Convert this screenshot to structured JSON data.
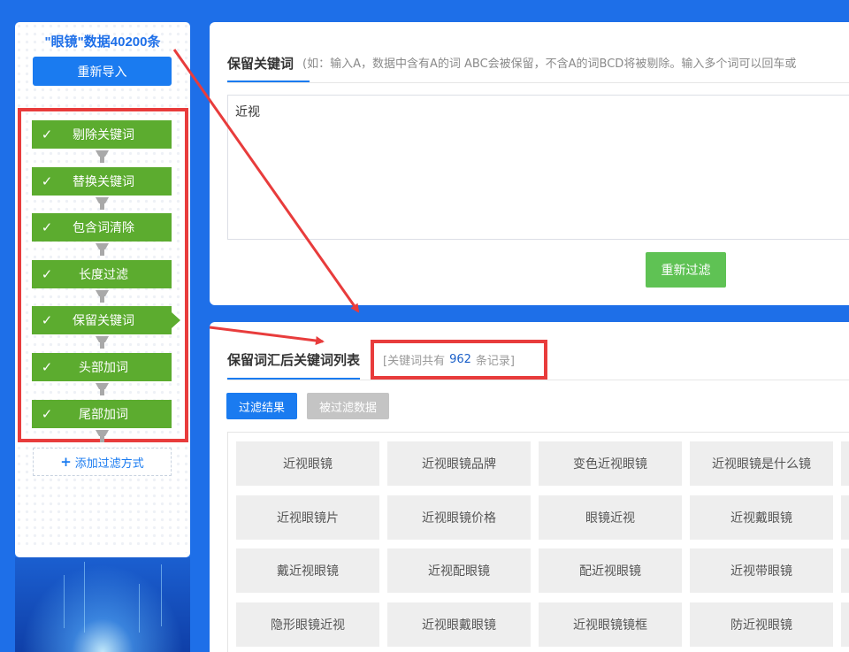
{
  "sidebar": {
    "dataset_title": "\"眼镜\"数据40200条",
    "reimport_label": "重新导入",
    "check_glyph": "✓",
    "steps": [
      {
        "label": "剔除关键词"
      },
      {
        "label": "替换关键词"
      },
      {
        "label": "包含词清除"
      },
      {
        "label": "长度过滤"
      },
      {
        "label": "保留关键词"
      },
      {
        "label": "头部加词"
      },
      {
        "label": "尾部加词"
      }
    ],
    "active_step": "保留关键词",
    "add_filter_label": "添加过滤方式"
  },
  "keep_panel": {
    "tab_label": "保留关键词",
    "hint": "(如：输入A，数据中含有A的词 ABC会被保留，不含A的词BCD将被剔除。输入多个词可以回车或",
    "keyword_value": "近视",
    "refilter_label": "重新过滤"
  },
  "result_panel": {
    "tab_label": "保留词汇后关键词列表",
    "count_prefix": "[关键词共有",
    "count_value": "962",
    "count_suffix": "条记录]",
    "btn_result_label": "过滤结果",
    "btn_filtered_label": "被过滤数据",
    "keywords": [
      [
        "近视眼镜",
        "近视眼镜品牌",
        "变色近视眼镜",
        "近视眼镜是什么镜"
      ],
      [
        "近视眼镜片",
        "近视眼镜价格",
        "眼镜近视",
        "近视戴眼镜"
      ],
      [
        "戴近视眼镜",
        "近视配眼镜",
        "配近视眼镜",
        "近视带眼镜"
      ],
      [
        "隐形眼镜近视",
        "近视眼戴眼镜",
        "近视眼镜镜框",
        "防近视眼镜"
      ]
    ]
  },
  "colors": {
    "background": "#1e6fe8",
    "step_green": "#5cac2f",
    "primary_blue": "#1a7bf0",
    "highlight_red": "#e83c3c",
    "refilter_green": "#5fc254"
  },
  "icons": [
    "check-icon",
    "funnel-icon",
    "plus-icon",
    "arrow-icon"
  ]
}
